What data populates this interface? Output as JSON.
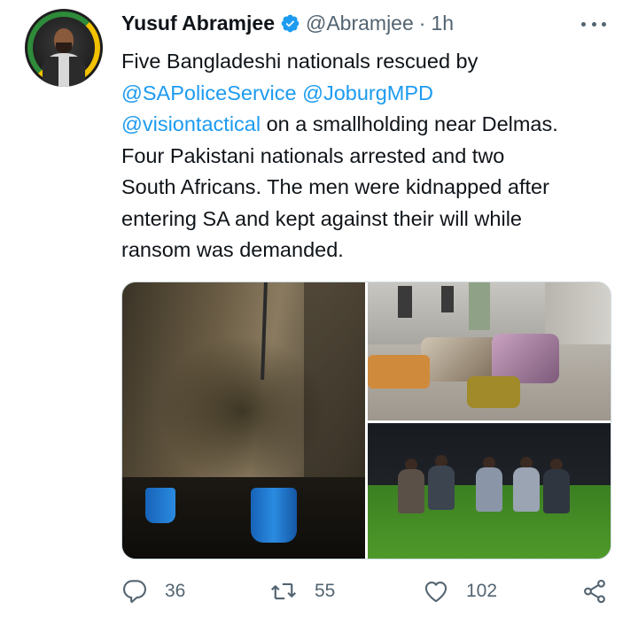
{
  "tweet": {
    "author_name": "Yusuf Abramjee",
    "handle": "@Abramjee",
    "separator": "·",
    "time": "1h",
    "text_lines": [
      {
        "plain_before": "Five Bangladeshi  nationals rescued by",
        "mention": "",
        "plain_after": ""
      },
      {
        "plain_before": "",
        "mention": "@SAPoliceService @JoburgMPD",
        "plain_after": ""
      },
      {
        "plain_before": "",
        "mention": "@visiontactical",
        "plain_after": " on a smallholding near Delmas."
      },
      {
        "plain_before": "Four Pakistani nationals arrested and two",
        "mention": "",
        "plain_after": ""
      },
      {
        "plain_before": "South Africans. The men were kidnapped after",
        "mention": "",
        "plain_after": ""
      },
      {
        "plain_before": "entering SA and kept against their will while",
        "mention": "",
        "plain_after": ""
      },
      {
        "plain_before": "ransom was demanded.",
        "mention": "",
        "plain_after": ""
      }
    ]
  },
  "actions": {
    "reply_count": "36",
    "retweet_count": "55",
    "like_count": "102"
  },
  "icons": {
    "verified": "verified-badge-icon",
    "more": "more-dots-icon",
    "reply": "reply-icon",
    "retweet": "retweet-icon",
    "like": "heart-icon",
    "share": "share-icon"
  },
  "colors": {
    "text": "#0f1419",
    "secondary": "#536471",
    "link": "#1d9bf0",
    "border": "#cfd9de"
  }
}
